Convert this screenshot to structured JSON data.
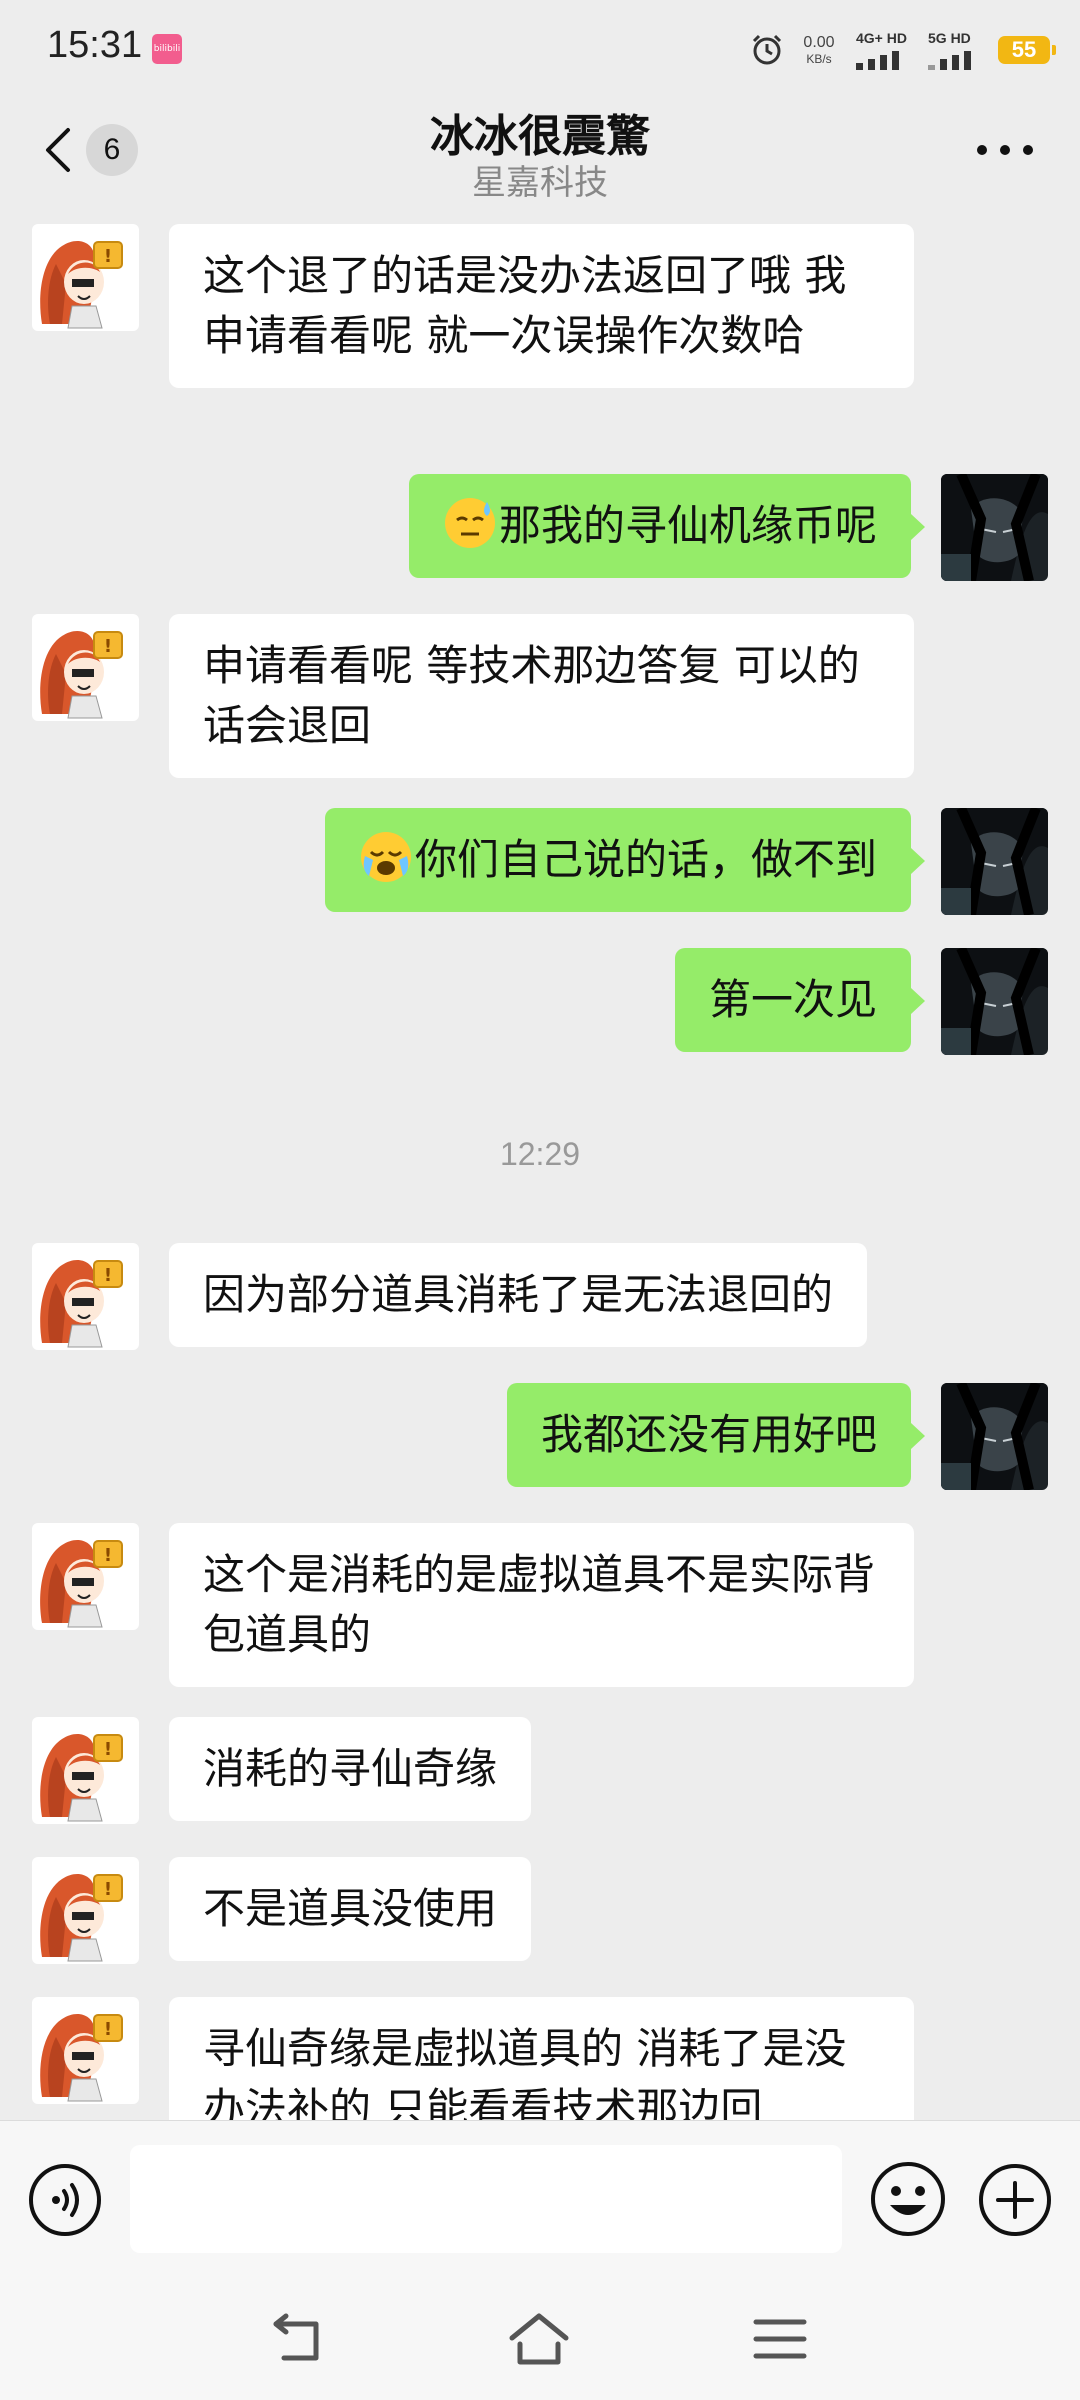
{
  "status_bar": {
    "time": "15:31",
    "app_icon_label": "bilibili",
    "net_speed_value": "0.00",
    "net_speed_unit": "KB/s",
    "sim1_label": "4G+ HD",
    "sim2_label": "5G HD",
    "battery": "55",
    "battery_color": "#f2b713"
  },
  "header": {
    "unread_count": "6",
    "title": "冰冰很震驚",
    "subtitle": "星嘉科技",
    "more_icon": "more-dots-icon",
    "back_icon": "chevron-left-icon"
  },
  "colors": {
    "outgoing_bubble": "#95ec69",
    "incoming_bubble": "#ffffff",
    "background": "#ededed"
  },
  "messages": [
    {
      "direction": "in",
      "text": "这个退了的话是没办法返回了哦 我申请看看呢 就一次误操作次数哈"
    },
    {
      "direction": "out",
      "emoji": "sweat-face-emoji",
      "text": "那我的寻仙机缘币呢"
    },
    {
      "direction": "in",
      "text": "申请看看呢 等技术那边答复 可以的话会退回"
    },
    {
      "direction": "out",
      "emoji": "loudly-crying-face-emoji",
      "text": "你们自己说的话，做不到"
    },
    {
      "direction": "out",
      "text": "第一次见"
    },
    {
      "direction": "in",
      "text": "因为部分道具消耗了是无法退回的"
    },
    {
      "direction": "out",
      "text": "我都还没有用好吧"
    },
    {
      "direction": "in",
      "text": "这个是消耗的是虚拟道具不是实际背包道具的"
    },
    {
      "direction": "in",
      "text": "消耗的寻仙奇缘"
    },
    {
      "direction": "in",
      "text": "不是道具没使用"
    },
    {
      "direction": "in",
      "text": "寻仙奇缘是虚拟道具的 消耗了是没办法补的 只能看看技术那边回"
    }
  ],
  "time_separator": "12:29",
  "input_bar": {
    "voice_icon": "voice-icon",
    "emoji_icon": "smiley-icon",
    "plus_icon": "plus-circle-icon",
    "input_value": ""
  },
  "nav_bar": {
    "back_icon": "nav-back-icon",
    "home_icon": "nav-home-icon",
    "menu_icon": "nav-menu-icon"
  }
}
